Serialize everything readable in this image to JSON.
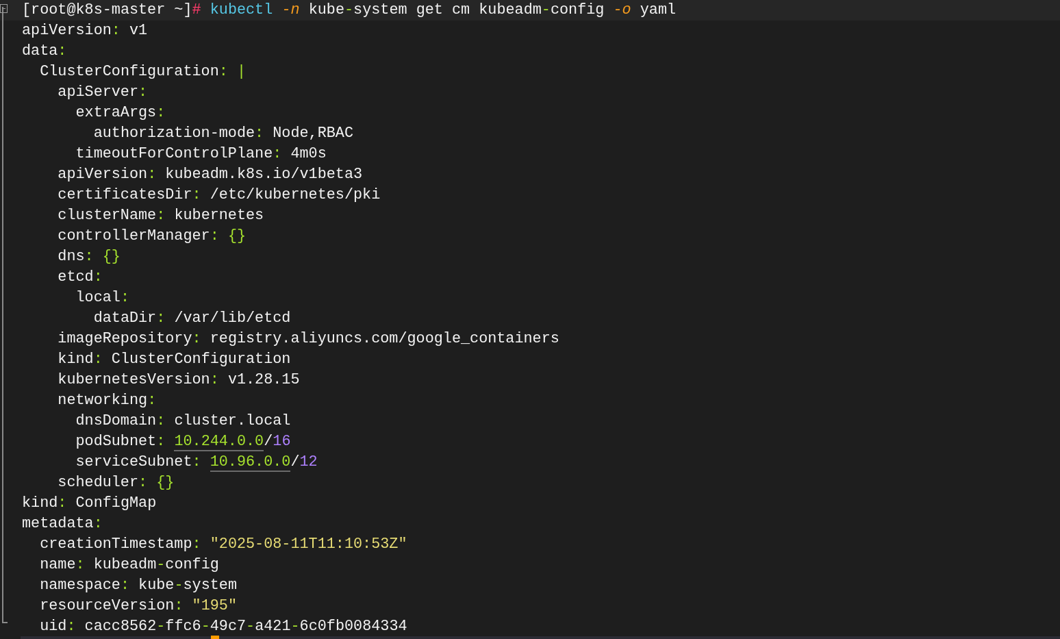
{
  "prompt": {
    "host": "[root@k8s-master ~]",
    "symbol": "#",
    "command": "kubectl",
    "args": [
      {
        "kind": "flag",
        "text": "-n"
      },
      {
        "kind": "word",
        "text": "kube-system"
      },
      {
        "kind": "word",
        "text": "get"
      },
      {
        "kind": "word",
        "text": "cm"
      },
      {
        "kind": "word",
        "text": "kubeadm-config"
      },
      {
        "kind": "flag",
        "text": "-o"
      },
      {
        "kind": "word",
        "text": "yaml"
      }
    ]
  },
  "yaml": [
    {
      "key": "apiVersion",
      "colon": ":",
      "value": [
        {
          "kind": "plain",
          "text": "v1"
        }
      ]
    },
    {
      "key": "data",
      "colon": ":",
      "children": [
        {
          "key": "ClusterConfiguration",
          "colon": ":",
          "value": [
            {
              "kind": "block",
              "text": "|"
            }
          ],
          "children": [
            {
              "key": "apiServer",
              "colon": ":",
              "children": [
                {
                  "key": "extraArgs",
                  "colon": ":",
                  "children": [
                    {
                      "key": "authorization-mode",
                      "colon": ":",
                      "value": [
                        {
                          "kind": "plain",
                          "text": "Node,RBAC"
                        }
                      ]
                    }
                  ]
                },
                {
                  "key": "timeoutForControlPlane",
                  "colon": ":",
                  "value": [
                    {
                      "kind": "plain",
                      "text": "4m0s"
                    }
                  ]
                }
              ]
            },
            {
              "key": "apiVersion",
              "colon": ":",
              "value": [
                {
                  "kind": "plain",
                  "text": "kubeadm.k8s.io/v1beta3"
                }
              ]
            },
            {
              "key": "certificatesDir",
              "colon": ":",
              "value": [
                {
                  "kind": "plain",
                  "text": "/etc/kubernetes/pki"
                }
              ]
            },
            {
              "key": "clusterName",
              "colon": ":",
              "value": [
                {
                  "kind": "plain",
                  "text": "kubernetes"
                }
              ]
            },
            {
              "key": "controllerManager",
              "colon": ":",
              "value": [
                {
                  "kind": "block",
                  "text": "{}"
                }
              ]
            },
            {
              "key": "dns",
              "colon": ":",
              "value": [
                {
                  "kind": "block",
                  "text": "{}"
                }
              ]
            },
            {
              "key": "etcd",
              "colon": ":",
              "children": [
                {
                  "key": "local",
                  "colon": ":",
                  "children": [
                    {
                      "key": "dataDir",
                      "colon": ":",
                      "value": [
                        {
                          "kind": "plain",
                          "text": "/var/lib/etcd"
                        }
                      ]
                    }
                  ]
                }
              ]
            },
            {
              "key": "imageRepository",
              "colon": ":",
              "value": [
                {
                  "kind": "plain",
                  "text": "registry.aliyuncs.com/google_containers"
                }
              ]
            },
            {
              "key": "kind",
              "colon": ":",
              "value": [
                {
                  "kind": "plain",
                  "text": "ClusterConfiguration"
                }
              ]
            },
            {
              "key": "kubernetesVersion",
              "colon": ":",
              "value": [
                {
                  "kind": "plain",
                  "text": "v1.28.15"
                }
              ]
            },
            {
              "key": "networking",
              "colon": ":",
              "children": [
                {
                  "key": "dnsDomain",
                  "colon": ":",
                  "value": [
                    {
                      "kind": "plain",
                      "text": "cluster.local"
                    }
                  ]
                },
                {
                  "key": "podSubnet",
                  "colon": ":",
                  "value": [
                    {
                      "kind": "link",
                      "text": "10.244.0.0"
                    },
                    {
                      "kind": "plain",
                      "text": "/"
                    },
                    {
                      "kind": "number",
                      "text": "16"
                    }
                  ]
                },
                {
                  "key": "serviceSubnet",
                  "colon": ":",
                  "value": [
                    {
                      "kind": "link",
                      "text": "10.96.0.0"
                    },
                    {
                      "kind": "plain",
                      "text": "/"
                    },
                    {
                      "kind": "number",
                      "text": "12"
                    }
                  ]
                }
              ]
            },
            {
              "key": "scheduler",
              "colon": ":",
              "value": [
                {
                  "kind": "block",
                  "text": "{}"
                }
              ]
            }
          ]
        }
      ]
    },
    {
      "key": "kind",
      "colon": ":",
      "value": [
        {
          "kind": "plain",
          "text": "ConfigMap"
        }
      ]
    },
    {
      "key": "metadata",
      "colon": ":",
      "children": [
        {
          "key": "creationTimestamp",
          "colon": ":",
          "value": [
            {
              "kind": "string",
              "text": "\"2025-08-11T11:10:53Z\""
            }
          ]
        },
        {
          "key": "name",
          "colon": ":",
          "value": [
            {
              "kind": "plain",
              "text": "kubeadm-config"
            }
          ]
        },
        {
          "key": "namespace",
          "colon": ":",
          "value": [
            {
              "kind": "plain",
              "text": "kube-system"
            }
          ]
        },
        {
          "key": "resourceVersion",
          "colon": ":",
          "value": [
            {
              "kind": "string",
              "text": "\"195\""
            }
          ]
        },
        {
          "key": "uid",
          "colon": ":",
          "value": [
            {
              "kind": "plain",
              "text": "cacc8562-ffc6-49c7-a421-6c0fb0084334"
            }
          ]
        }
      ]
    }
  ]
}
